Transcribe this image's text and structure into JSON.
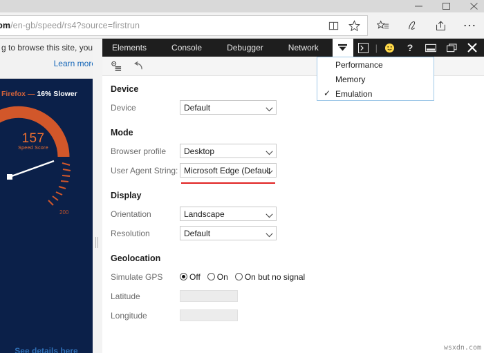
{
  "window": {
    "controls": [
      "minimize",
      "maximize",
      "close"
    ]
  },
  "browser": {
    "url_host": "ft.com",
    "url_path": "/en-gb/speed/rs4?source=firstrun",
    "address_icons": [
      "reading-view-icon",
      "favorite-star-icon"
    ],
    "toolbar_icons": [
      "hub-favorites-icon",
      "web-note-icon",
      "share-icon",
      "more-icon"
    ]
  },
  "page": {
    "cookie_notice": "g to browse this site, you",
    "cookie_link": "Learn more",
    "hero": {
      "headline_browser": "Firefox",
      "headline_sep": "—",
      "headline_value": "16% Slower",
      "score": "157",
      "score_label": "Speed Score",
      "gauge_max_label": "200",
      "footer_link": "See details here"
    }
  },
  "devtools": {
    "tabs": [
      {
        "label": "Elements",
        "active": false
      },
      {
        "label": "Console",
        "active": false
      },
      {
        "label": "Debugger",
        "active": false
      },
      {
        "label": "Network",
        "active": false
      }
    ],
    "overflow_button": "chevron-down-icon",
    "right_icons": [
      "console-drawer-icon",
      "feedback-smiley-icon",
      "help-icon",
      "dock-bottom-icon",
      "undock-icon",
      "close-icon"
    ],
    "toolbar_icons": [
      "settings-config-icon",
      "reset-icon"
    ],
    "menu": {
      "items": [
        {
          "label": "Performance",
          "checked": false
        },
        {
          "label": "Memory",
          "checked": false
        },
        {
          "label": "Emulation",
          "checked": true
        }
      ],
      "check_glyph": "✓"
    },
    "sections": [
      {
        "title": "Device",
        "rows": [
          {
            "label": "Device",
            "value": "Default",
            "type": "select"
          }
        ]
      },
      {
        "title": "Mode",
        "rows": [
          {
            "label": "Browser profile",
            "value": "Desktop",
            "type": "select"
          },
          {
            "label": "User Agent String:",
            "value": "Microsoft Edge (Default",
            "type": "select"
          }
        ]
      },
      {
        "title": "Display",
        "rows": [
          {
            "label": "Orientation",
            "value": "Landscape",
            "type": "select"
          },
          {
            "label": "Resolution",
            "value": "Default",
            "type": "select"
          }
        ]
      },
      {
        "title": "Geolocation",
        "rows": [
          {
            "label": "Simulate GPS",
            "type": "radio"
          },
          {
            "label": "Latitude",
            "value": "",
            "type": "text"
          },
          {
            "label": "Longitude",
            "value": "",
            "type": "text"
          }
        ]
      }
    ],
    "gps_options": [
      {
        "label": "Off",
        "selected": true
      },
      {
        "label": "On",
        "selected": false
      },
      {
        "label": "On but no signal",
        "selected": false
      }
    ]
  },
  "colors": {
    "devtools_tabbar": "#1e1e1e",
    "hero_bg": "#0b2049",
    "gauge_orange": "#d2572a",
    "score_orange": "#f07030",
    "link_blue": "#1466b8",
    "red_underline": "#e02020",
    "menu_border": "#9fc8e8"
  },
  "watermark": "wsxdn.com"
}
